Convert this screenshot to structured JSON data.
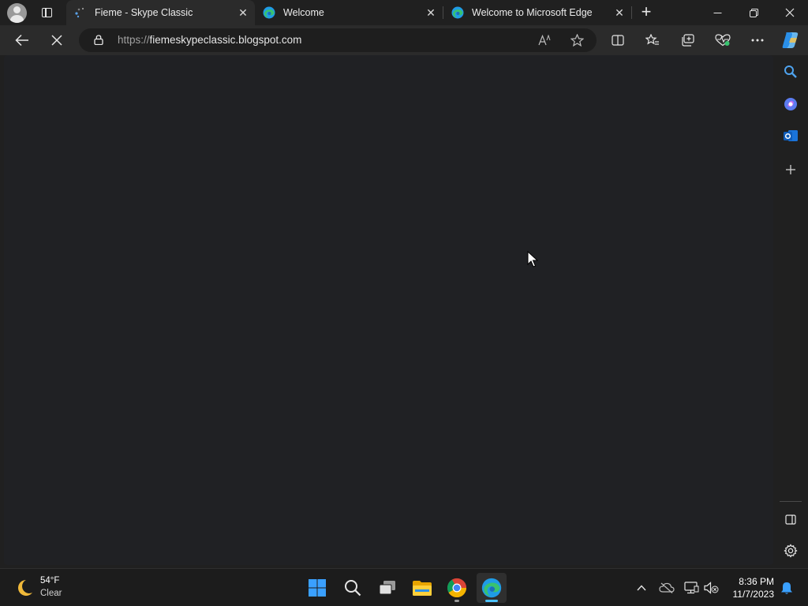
{
  "tabs": [
    {
      "label": "Fieme - Skype Classic",
      "favicon": "dots-loading-icon",
      "active": true
    },
    {
      "label": "Welcome",
      "favicon": "edge-icon",
      "active": false
    },
    {
      "label": "Welcome to Microsoft Edge",
      "favicon": "edge-icon",
      "active": false
    }
  ],
  "address": {
    "scheme": "https://",
    "host": "fiemeskypeclassic.blogspot.com"
  },
  "taskbar": {
    "weather": {
      "temp": "54°F",
      "condition": "Clear"
    },
    "clock": {
      "time": "8:36 PM",
      "date": "11/7/2023"
    }
  },
  "colors": {
    "edge_blue": "#1f9ce6",
    "edge_green": "#39c26f",
    "windows_blue": "#3aa0ff",
    "page_background": "#202124"
  }
}
